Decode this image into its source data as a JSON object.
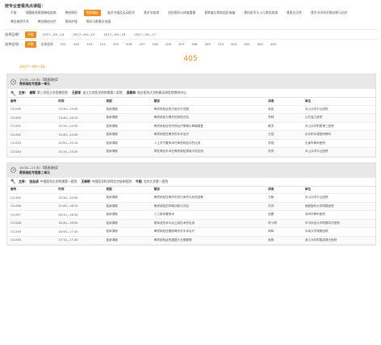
{
  "header": {
    "title": "按专业查看亮点课程：",
    "topics": [
      {
        "label": "不限",
        "active": false
      },
      {
        "label": "颈腰椎和周围神经疾病",
        "active": false
      },
      {
        "label": "脊柱畸形",
        "active": false
      },
      {
        "label": "骨质疏松",
        "active": true
      },
      {
        "label": "肩关节镜及运动医学",
        "active": false
      },
      {
        "label": "骨关节疾病",
        "active": false
      },
      {
        "label": "创伤骨科与修复重建",
        "active": false
      },
      {
        "label": "骨肿瘤与骨软组织肉瘤",
        "active": false
      },
      {
        "label": "骨科医学与小儿骨科疾病",
        "active": false
      },
      {
        "label": "骨肌先天性",
        "active": false
      },
      {
        "label": "骨关节炎的早期诊断与治疗",
        "active": false
      },
      {
        "label": "脊柱病例手术",
        "active": false
      },
      {
        "label": "脊柱微创治疗",
        "active": false
      },
      {
        "label": "骨科护理",
        "active": false
      },
      {
        "label": "骨科与影像学进展",
        "active": false
      }
    ]
  },
  "date_filter": {
    "label": "选择日期：",
    "options": [
      {
        "label": "不限",
        "active": true
      },
      {
        "label": "2017—09—14",
        "active": false
      },
      {
        "label": "2017—09—15",
        "active": false
      },
      {
        "label": "2017—09—16",
        "active": false
      },
      {
        "label": "2017—09—17",
        "active": false
      }
    ]
  },
  "room_filter": {
    "label": "选择会场：",
    "options": [
      {
        "label": "不限",
        "active": true
      },
      {
        "label": "全体会场",
        "active": false
      },
      {
        "label": "101",
        "active": false
      },
      {
        "label": "102",
        "active": false
      },
      {
        "label": "103",
        "active": false
      },
      {
        "label": "104",
        "active": false
      },
      {
        "label": "105",
        "active": false
      },
      {
        "label": "106",
        "active": false
      },
      {
        "label": "107",
        "active": false
      },
      {
        "label": "108",
        "active": false
      },
      {
        "label": "109",
        "active": false
      },
      {
        "label": "307",
        "active": false
      },
      {
        "label": "308",
        "active": false
      },
      {
        "label": "309",
        "active": false
      },
      {
        "label": "310",
        "active": false
      },
      {
        "label": "401",
        "active": false
      },
      {
        "label": "402",
        "active": false
      },
      {
        "label": "403",
        "active": false
      },
      {
        "label": "405",
        "active": false
      }
    ]
  },
  "room_title": "405",
  "date": "2017—09—16",
  "columns": [
    "编号",
    "时间",
    "类型",
    "题目",
    "讲者",
    "单位"
  ],
  "sessions": [
    {
      "time": "13:30—15:30 【骨质疏松】",
      "name": "骨质疏松专题第一单元",
      "hosts_label": "主持：",
      "hosts": [
        {
          "name": "谢辉",
          "org": "第三军医大学西南医院"
        },
        {
          "name": "王欧军",
          "org": "浙江大学医学院附属第二医院"
        },
        {
          "name": "吴朝林",
          "org": "南方医科大学附属深圳医院骨科中心"
        }
      ],
      "rows": [
        [
          "CS-030",
          "13:30—13:40",
          "独家课程",
          "骨质疏松症的中医诊疗进展",
          "吴宏",
          "中山大学中山医院"
        ],
        [
          "CS-040",
          "13:40—14:10",
          "独家课程",
          "骨质疏松与骨折的风险评估",
          "李莉",
          "山东省立医院"
        ],
        [
          "CS-041",
          "14:10—14:30",
          "独家课程",
          "骨质疏松症的药物治疗策略与骨骼康复",
          "戴杰",
          "中山大学附属第三医院"
        ],
        [
          "CS-042",
          "14:30—14:50",
          "独家课程",
          "骨质疏松性骨折的手术治疗",
          "王斌",
          "北京积水潭医院骨科"
        ],
        [
          "CS-043",
          "14:50—15:10",
          "独家课程",
          "人工关节置换术在骨质疏松中的应用",
          "李强",
          "天津市骨科医院"
        ],
        [
          "CS-044",
          "15:10—15:30",
          "独家课程",
          "脊柱微创手术在骨质疏松患者中的应用",
          "张亮",
          "中山大学中山医院"
        ]
      ]
    },
    {
      "time": "15:30—17:30 【骨质疏松】",
      "name": "骨质疏松专题第二单元",
      "hosts_label": "主持：",
      "hosts": [
        {
          "name": "张志成",
          "org": "中国医科大学附属第一医院"
        },
        {
          "name": "王晓明",
          "org": "中国医学科学院北京协和医院"
        },
        {
          "name": "牛刚",
          "org": "北京大学第一医院"
        }
      ],
      "rows": [
        [
          "CS-045",
          "15:30—15:40",
          "独家课程",
          "骨质疏松性骨折的流行病学与危险因素",
          "王敏",
          "中山大学中山医院"
        ],
        [
          "CS-046",
          "15:40—16:10",
          "独家课程",
          "骨质疏松的早期诊断与评估",
          "刘洋",
          "首都医科大学附属医院"
        ],
        [
          "CS-047",
          "16:10—16:30",
          "独家课程",
          "人工椎体置换术",
          "赵鹏",
          "深圳市骨科医院"
        ],
        [
          "CS-048",
          "16:30—16:50",
          "独家课程",
          "椎体成形术与后凸成形术的应用",
          "陈小丽",
          "华中科技大学附属同济医院"
        ],
        [
          "CS-049",
          "16:50—17:10",
          "独家课程",
          "骨质疏松性髋部骨折的手术治疗",
          "周辉",
          "中南大学湘雅医院"
        ],
        [
          "CS-050",
          "17:10—17:30",
          "独家课程",
          "骨质疏松症的康复与长期管理",
          "吴刚",
          "浙江大学附属邵逸夫医院"
        ]
      ]
    }
  ]
}
